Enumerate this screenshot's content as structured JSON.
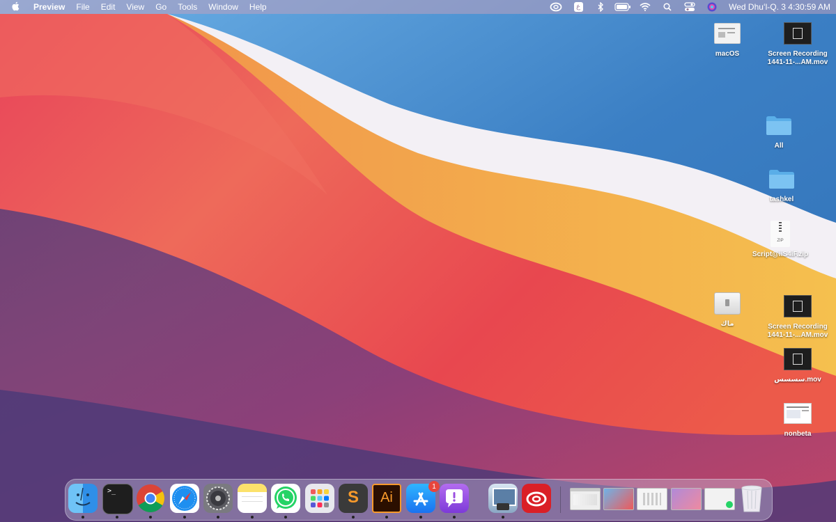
{
  "menubar": {
    "apple_icon": "apple-icon",
    "app_name": "Preview",
    "menus": [
      "File",
      "Edit",
      "View",
      "Go",
      "Tools",
      "Window",
      "Help"
    ],
    "status_icons": [
      "creative-cloud-icon",
      "keyboard-input-icon",
      "bluetooth-icon",
      "battery-icon",
      "wifi-icon",
      "spotlight-search-icon",
      "control-center-icon",
      "siri-icon"
    ],
    "input_badge": "ع",
    "clock": "Wed Dhuʻl-Q. 3  4:30:59 AM"
  },
  "desktop": {
    "items": [
      {
        "label": "macOS",
        "icon": "document-icon"
      },
      {
        "label": "Screen Recording\n1441-11-...AM.mov",
        "icon": "video-icon"
      },
      {
        "label": "All",
        "icon": "folder-icon"
      },
      {
        "label": "tashkel",
        "icon": "folder-icon"
      },
      {
        "label": "Script@iiS4iF.zip",
        "icon": "zip-icon",
        "badge": "ZIP"
      },
      {
        "label": "ماك",
        "icon": "disk-image-icon"
      },
      {
        "label": "Screen Recording\n1441-11-...AM.mov",
        "icon": "video-icon"
      },
      {
        "label": "سسسس.mov",
        "icon": "video-icon"
      },
      {
        "label": "nonbeta",
        "icon": "screenshot-icon"
      }
    ]
  },
  "dock": {
    "apps": [
      {
        "name": "finder-icon",
        "color": "#2b8ae8",
        "running": true
      },
      {
        "name": "terminal-icon",
        "color": "#1e1e1e",
        "running": true,
        "glyph": ">_"
      },
      {
        "name": "chrome-icon",
        "color": "#ffffff",
        "running": true
      },
      {
        "name": "safari-icon",
        "color": "#1e8ff0",
        "running": true
      },
      {
        "name": "system-preferences-icon",
        "color": "#8e8e93",
        "running": true
      },
      {
        "name": "notes-icon",
        "color": "#fce26b",
        "running": true
      },
      {
        "name": "whatsapp-icon",
        "color": "#25d366",
        "running": true
      },
      {
        "name": "launchpad-icon",
        "color": "#e0e0e0",
        "running": false
      },
      {
        "name": "sublime-text-icon",
        "color": "#3a3a3a",
        "running": true,
        "glyph": "S"
      },
      {
        "name": "illustrator-icon",
        "color": "#2b0f00",
        "running": true,
        "glyph": "Ai"
      },
      {
        "name": "app-store-icon",
        "color": "#1a8cf5",
        "running": true,
        "badge": "1"
      },
      {
        "name": "feedback-assistant-icon",
        "color": "#9b4fe0",
        "running": true
      },
      {
        "name": "preview-icon",
        "color": "#d9e6f2",
        "running": true
      },
      {
        "name": "creative-cloud-icon",
        "color": "#da1f26",
        "running": false
      }
    ],
    "minimized_windows": 5,
    "trash": "trash-icon"
  }
}
